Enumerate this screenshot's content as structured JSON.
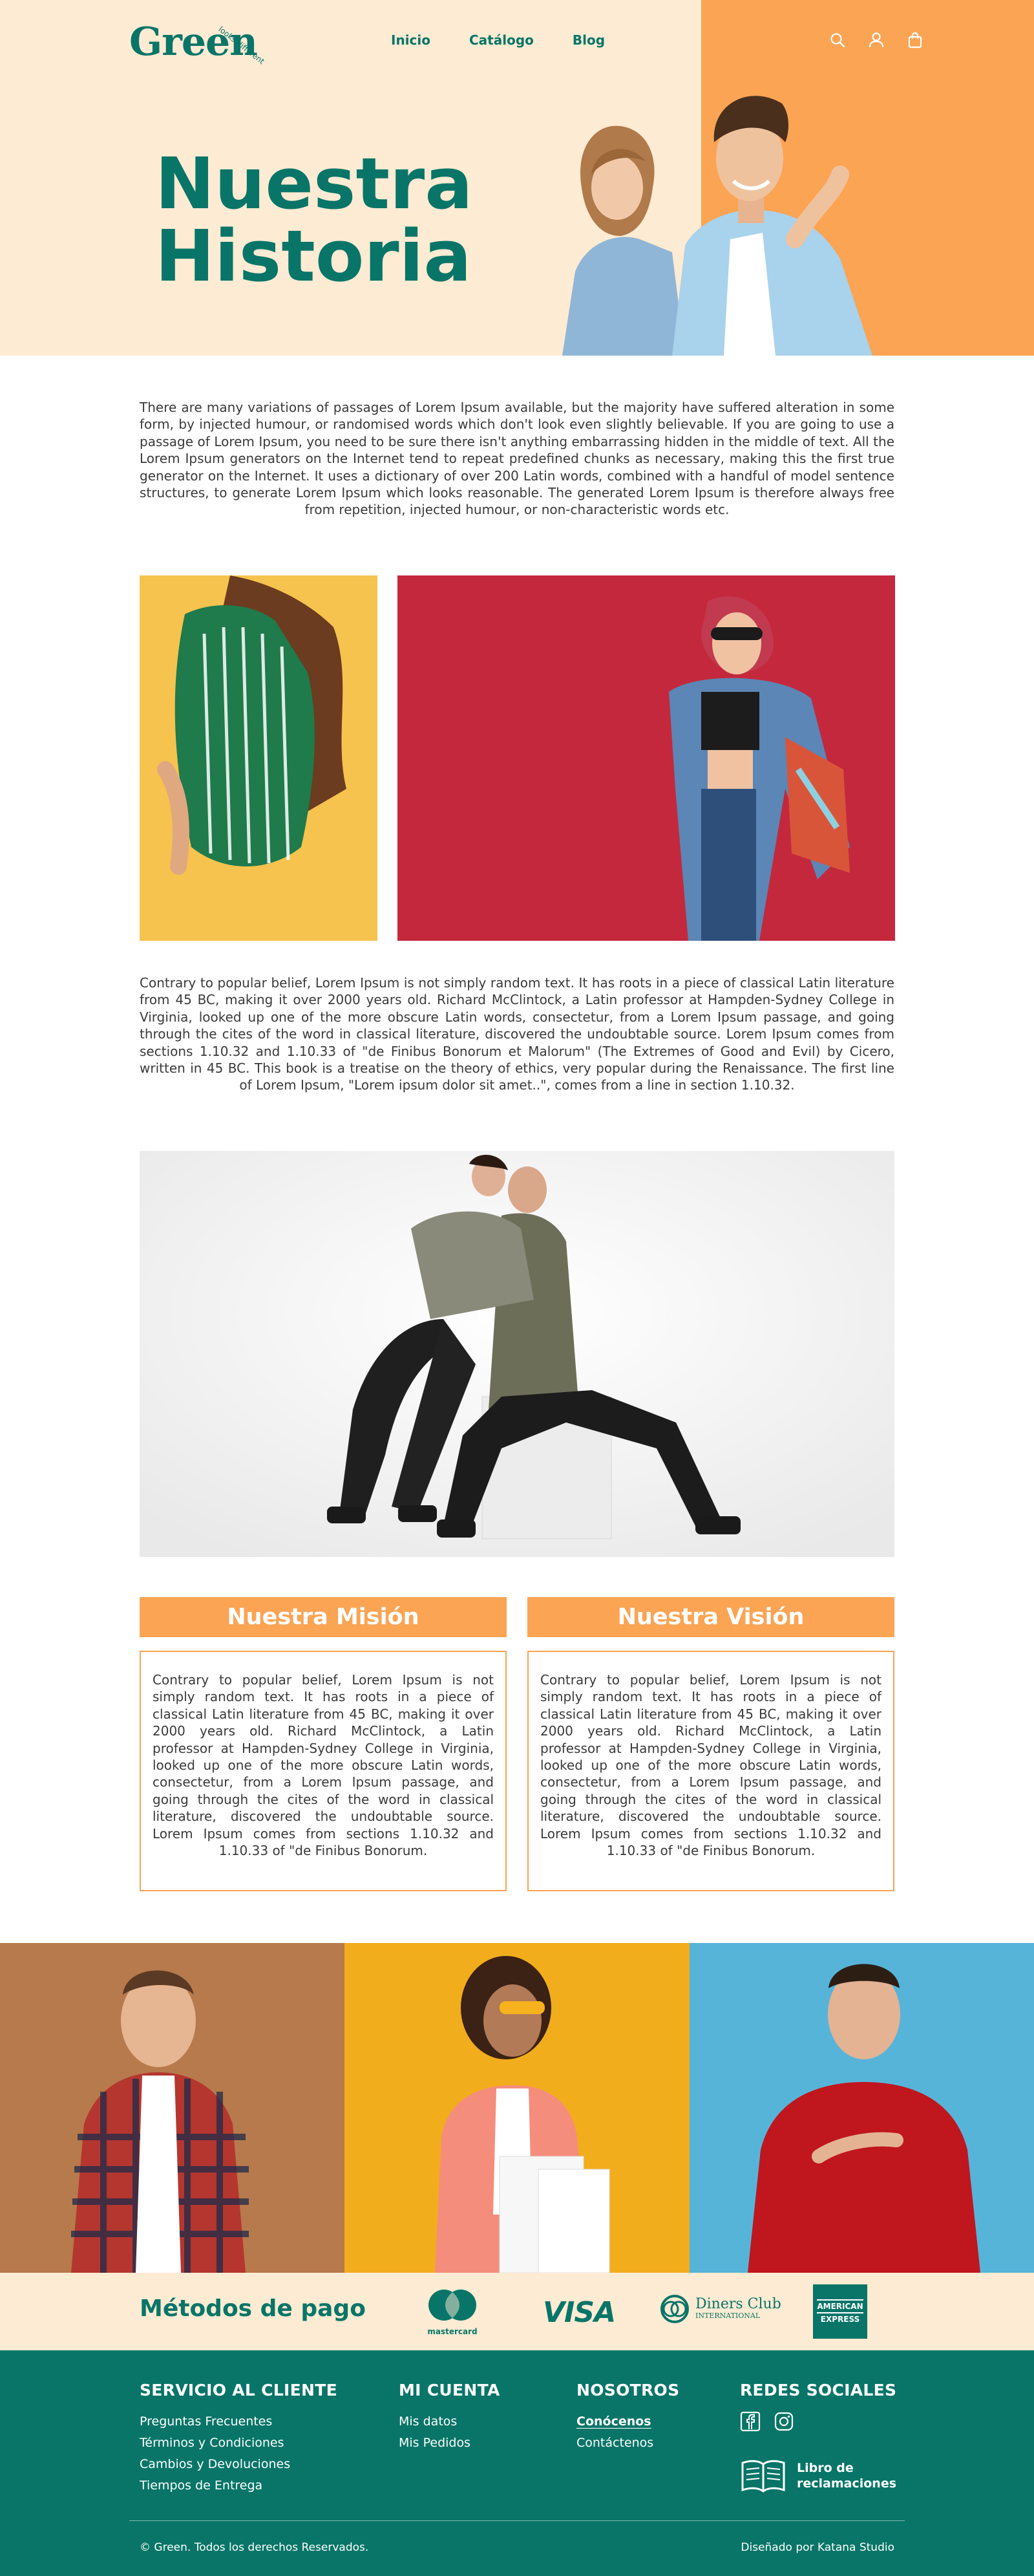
{
  "header": {
    "logo": "Green",
    "logo_tagline": "looks different",
    "nav": [
      "Inicio",
      "Catálogo",
      "Blog"
    ],
    "icons": [
      "search-icon",
      "user-icon",
      "bag-icon"
    ]
  },
  "hero": {
    "title_line1": "Nuestra",
    "title_line2": "Historia"
  },
  "intro": {
    "text": "There are many variations of passages of Lorem Ipsum available, but the majority have suffered alteration in some form, by injected humour, or randomised words which don't look even slightly believable. If you are going to use a passage of Lorem Ipsum, you need to be sure there isn't anything embarrassing hidden in the middle of text. All the Lorem Ipsum generators on the Internet tend to repeat predefined chunks as necessary, making this the first true generator on the Internet. It uses a dictionary of over 200 Latin words, combined with a handful of model sentence structures, to generate Lorem Ipsum which looks reasonable. The generated Lorem Ipsum is therefore always free from repetition, injected humour, or non-characteristic words etc."
  },
  "history": {
    "text": "Contrary to popular belief, Lorem Ipsum is not simply random text. It has roots in a piece of classical Latin literature from 45 BC, making it over 2000 years old. Richard McClintock, a Latin professor at Hampden-Sydney College in Virginia, looked up one of the more obscure Latin words, consectetur, from a Lorem Ipsum passage, and going through the cites of the word in classical literature, discovered the undoubtable source. Lorem Ipsum comes from sections 1.10.32 and 1.10.33 of \"de Finibus Bonorum et Malorum\" (The Extremes of Good and Evil) by Cicero, written in 45 BC. This book is a treatise on the theory of ethics, very popular during the Renaissance. The first line of Lorem Ipsum, \"Lorem ipsum dolor sit amet..\", comes from a line in section 1.10.32."
  },
  "mission": {
    "title": "Nuestra Misión",
    "text": "Contrary to popular belief, Lorem Ipsum is not simply random text. It has roots in a piece of classical Latin literature from 45 BC, making it over 2000 years old. Richard McClintock, a Latin professor at Hampden-Sydney College in Virginia, looked up one of the more obscure Latin words, consectetur, from a Lorem Ipsum passage, and going through the cites of the word in classical literature, discovered the undoubtable source. Lorem Ipsum comes from sections 1.10.32 and 1.10.33 of \"de Finibus Bonorum."
  },
  "vision": {
    "title": "Nuestra Visión",
    "text": "Contrary to popular belief, Lorem Ipsum is not simply random text. It has roots in a piece of classical Latin literature from 45 BC, making it over 2000 years old. Richard McClintock, a Latin professor at Hampden-Sydney College in Virginia, looked up one of the more obscure Latin words, consectetur, from a Lorem Ipsum passage, and going through the cites of the word in classical literature, discovered the undoubtable source. Lorem Ipsum comes from sections 1.10.32 and 1.10.33 of \"de Finibus Bonorum."
  },
  "payments": {
    "title": "Métodos de pago",
    "mastercard": "mastercard",
    "visa": "VISA",
    "diners_line1": "Diners Club",
    "diners_line2": "INTERNATIONAL",
    "amex_line1": "AMERICAN",
    "amex_line2": "EXPRESS"
  },
  "footer": {
    "customer_service": {
      "title": "SERVICIO AL CLIENTE",
      "links": [
        "Preguntas Frecuentes",
        "Términos y Condiciones",
        "Cambios y Devoluciones",
        "Tiempos de Entrega"
      ]
    },
    "account": {
      "title": "MI CUENTA",
      "links": [
        "Mis datos",
        "Mis Pedidos"
      ]
    },
    "about": {
      "title": "NOSOTROS",
      "links": [
        "Conócenos",
        "Contáctenos"
      ]
    },
    "social": {
      "title": "REDES SOCIALES",
      "icons": [
        "facebook-icon",
        "instagram-icon"
      ]
    },
    "libro_line1": "Libro de",
    "libro_line2": "reclamaciones",
    "copyright": "© Green. Todos los derechos Reservados.",
    "credit": "Diseñado por Katana Studio"
  },
  "colors": {
    "teal": "#087568",
    "orange": "#fba454",
    "cream": "#fdebd3"
  }
}
